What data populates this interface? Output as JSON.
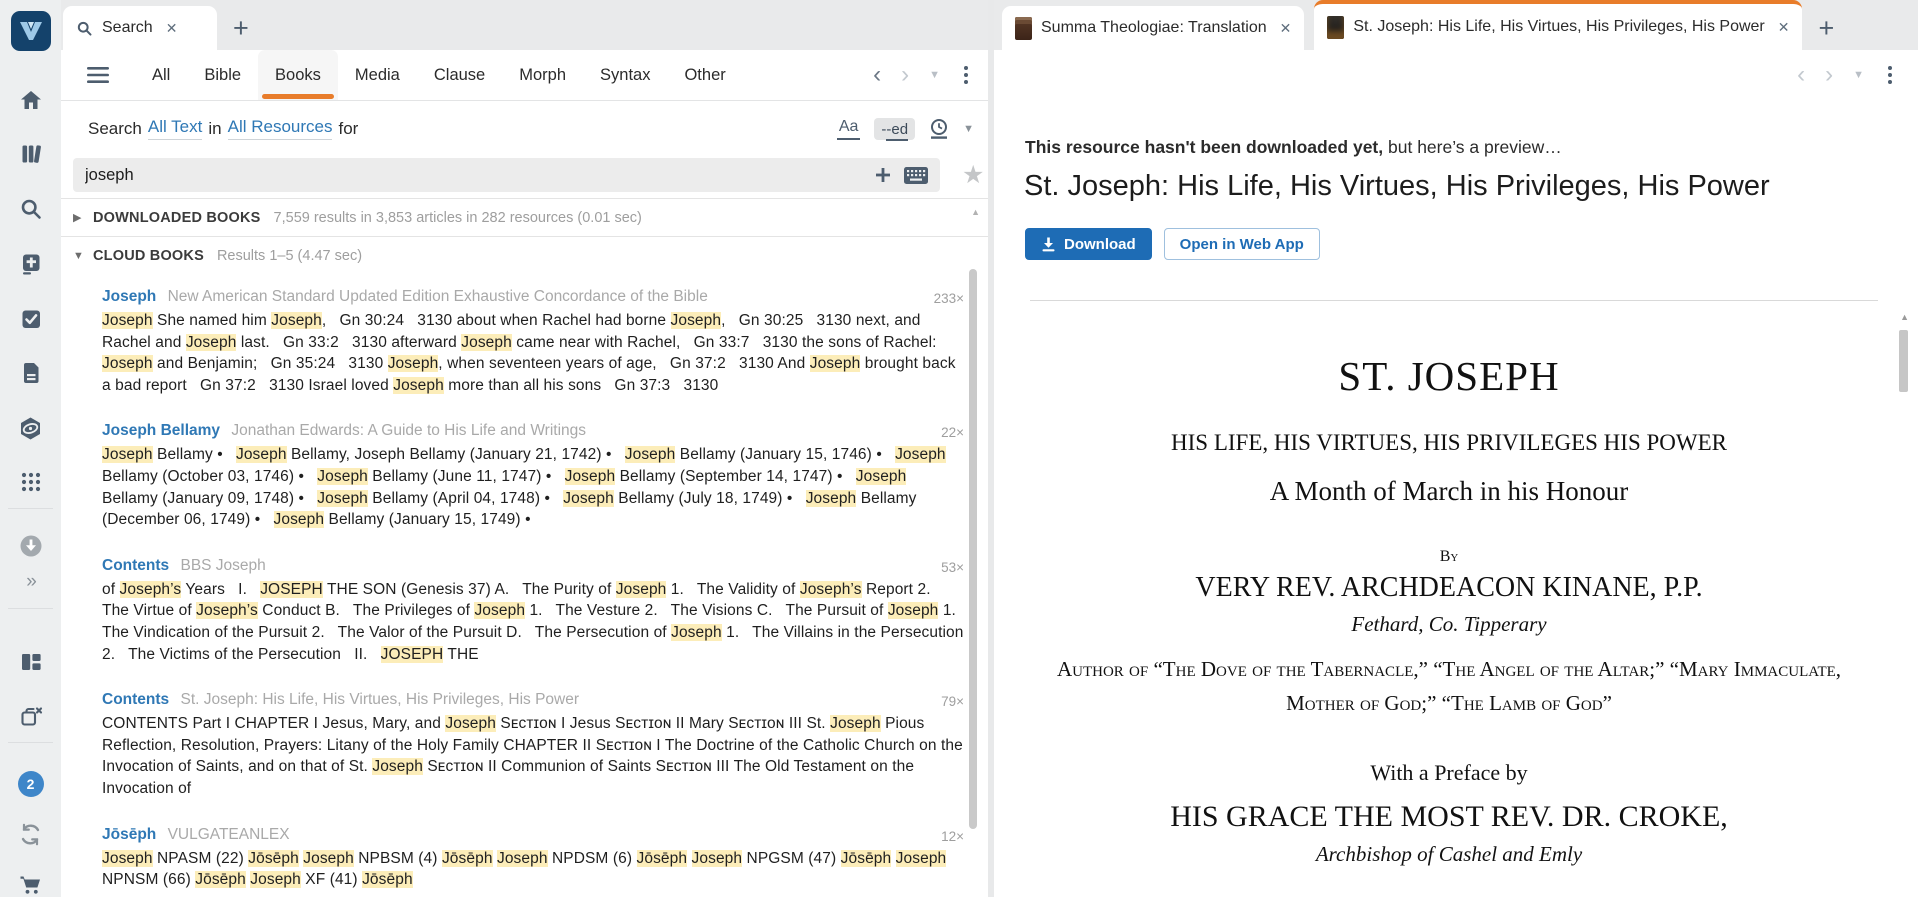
{
  "colors": {
    "accent_orange": "#e87c2a",
    "link_blue": "#2f78b5",
    "highlight_yellow": "#fcedb9",
    "button_blue": "#1e6cb5",
    "sidebar_bg": "#edeff0",
    "icon_slate": "#4d5d6e"
  },
  "sidebar": {
    "badge_count": "2",
    "icons": [
      "logos-logo-icon",
      "home-icon",
      "library-icon",
      "search-icon",
      "bible-cross-icon",
      "guides-check-icon",
      "documents-icon",
      "atlas-icon",
      "apps-grid-icon",
      "downloads-icon",
      "expand-chevrons-icon",
      "layouts-icon",
      "close-all-panels-icon",
      "notifications-badge",
      "sync-icon",
      "store-cart-icon"
    ]
  },
  "left_panel": {
    "tab_label": "Search",
    "new_tab_label": "+",
    "nav_tabs": [
      {
        "label": "All",
        "active": false
      },
      {
        "label": "Bible",
        "active": false
      },
      {
        "label": "Books",
        "active": true
      },
      {
        "label": "Media",
        "active": false
      },
      {
        "label": "Clause",
        "active": false
      },
      {
        "label": "Morph",
        "active": false
      },
      {
        "label": "Syntax",
        "active": false
      },
      {
        "label": "Other",
        "active": false
      }
    ],
    "criteria": {
      "prefix": "Search",
      "all_text": "All Text",
      "in_word": "in",
      "all_resources": "All Resources",
      "suffix": "for"
    },
    "match_case_label": "Aa",
    "match_forms_label": "-ed",
    "query": "joseph",
    "sections": {
      "downloaded": {
        "label": "DOWNLOADED BOOKS",
        "summary": "7,559 results in 3,853 articles in 282 resources (0.01 sec)"
      },
      "cloud": {
        "label": "CLOUD BOOKS",
        "summary": "Results 1–5 (4.47 sec)"
      }
    },
    "results": [
      {
        "title": "Joseph",
        "source": "New American Standard Updated Edition Exhaustive Concordance of the Bible",
        "count": "233×",
        "snippet": [
          [
            "Joseph",
            1
          ],
          [
            " She named him ",
            0
          ],
          [
            "Joseph",
            1
          ],
          [
            ",   Gn 30:24   3130 about when Rachel had borne ",
            0
          ],
          [
            "Joseph",
            1
          ],
          [
            ",   Gn 30:25   3130 next, and Rachel and ",
            0
          ],
          [
            "Joseph",
            1
          ],
          [
            " last.   Gn 33:2   3130 afterward ",
            0
          ],
          [
            "Joseph",
            1
          ],
          [
            " came near with Rachel,   Gn 33:7   3130 the sons of Rachel: ",
            0
          ],
          [
            "Joseph",
            1
          ],
          [
            " and Benjamin;   Gn 35:24   3130 ",
            0
          ],
          [
            "Joseph",
            1
          ],
          [
            ", when seventeen years of age,   Gn 37:2   3130 And ",
            0
          ],
          [
            "Joseph",
            1
          ],
          [
            " brought back a bad report   Gn 37:2   3130 Israel loved ",
            0
          ],
          [
            "Joseph",
            1
          ],
          [
            " more than all his sons   Gn 37:3   3130",
            0
          ]
        ]
      },
      {
        "title": "Joseph Bellamy",
        "source": "Jonathan Edwards: A Guide to His Life and Writings",
        "count": "22×",
        "snippet": [
          [
            "Joseph",
            1
          ],
          [
            " Bellamy •   ",
            0
          ],
          [
            "Joseph",
            1
          ],
          [
            " Bellamy, Joseph Bellamy (January 21, 1742) •   ",
            0
          ],
          [
            "Joseph",
            1
          ],
          [
            " Bellamy (January 15, 1746) •   ",
            0
          ],
          [
            "Joseph",
            1
          ],
          [
            " Bellamy (October 03, 1746) •   ",
            0
          ],
          [
            "Joseph",
            1
          ],
          [
            " Bellamy (June 11, 1747) •   ",
            0
          ],
          [
            "Joseph",
            1
          ],
          [
            " Bellamy (September 14, 1747) •   ",
            0
          ],
          [
            "Joseph",
            1
          ],
          [
            " Bellamy (January 09, 1748) •   ",
            0
          ],
          [
            "Joseph",
            1
          ],
          [
            " Bellamy (April 04, 1748) •   ",
            0
          ],
          [
            "Joseph",
            1
          ],
          [
            " Bellamy (July 18, 1749) •   ",
            0
          ],
          [
            "Joseph",
            1
          ],
          [
            " Bellamy (December 06, 1749) •   ",
            0
          ],
          [
            "Joseph",
            1
          ],
          [
            " Bellamy (January 15, 1749) •",
            0
          ]
        ]
      },
      {
        "title": "Contents",
        "source": "BBS Joseph",
        "count": "53×",
        "snippet": [
          [
            "of ",
            0
          ],
          [
            "Joseph’s",
            1
          ],
          [
            " Years   I.   ",
            0
          ],
          [
            "JOSEPH",
            1
          ],
          [
            " THE SON (Genesis 37) A.   The Purity of ",
            0
          ],
          [
            "Joseph",
            1
          ],
          [
            " 1.   The Validity of ",
            0
          ],
          [
            "Joseph’s",
            1
          ],
          [
            " Report 2.   The Virtue of ",
            0
          ],
          [
            "Joseph’s",
            1
          ],
          [
            " Conduct B.   The Privileges of ",
            0
          ],
          [
            "Joseph",
            1
          ],
          [
            " 1.   The Vesture 2.   The Visions C.   The Pursuit of ",
            0
          ],
          [
            "Joseph",
            1
          ],
          [
            " 1.   The Vindication of the Pursuit 2.   The Valor of the Pursuit D.   The Persecution of ",
            0
          ],
          [
            "Joseph",
            1
          ],
          [
            " 1.   The Villains in the Persecution 2.   The Victims of the Persecution   II.   ",
            0
          ],
          [
            "JOSEPH",
            1
          ],
          [
            " THE",
            0
          ]
        ]
      },
      {
        "title": "Contents",
        "source": "St. Joseph: His Life, His Virtues, His Privileges, His Power",
        "count": "79×",
        "snippet": [
          [
            "CONTENTS Part I CHAPTER I Jesus, Mary, and ",
            0
          ],
          [
            "Joseph",
            1
          ],
          [
            " Sᴇᴄᴛɪᴏɴ I Jesus Sᴇᴄᴛɪᴏɴ II Mary Sᴇᴄᴛɪᴏɴ III St. ",
            0
          ],
          [
            "Joseph",
            1
          ],
          [
            " Pious Reflection, Resolution, Prayers: Litany of the Holy Family CHAPTER II Sᴇᴄᴛɪᴏɴ I The Doctrine of the Catholic Church on the Invocation of Saints, and on that of St. ",
            0
          ],
          [
            "Joseph",
            1
          ],
          [
            " Sᴇᴄᴛɪᴏɴ II Communion of Saints Sᴇᴄᴛɪᴏɴ III The Old Testament on the Invocation of",
            0
          ]
        ]
      },
      {
        "title": "Jōsēph",
        "source": "VULGATEANLEX",
        "count": "12×",
        "snippet": [
          [
            "Joseph",
            1
          ],
          [
            " NPASM (22) ",
            0
          ],
          [
            "Jōsēph",
            1
          ],
          [
            " ",
            0
          ],
          [
            "Joseph",
            1
          ],
          [
            " NPBSM (4) ",
            0
          ],
          [
            "Jōsēph",
            1
          ],
          [
            " ",
            0
          ],
          [
            "Joseph",
            1
          ],
          [
            " NPDSM (6) ",
            0
          ],
          [
            "Jōsēph",
            1
          ],
          [
            " ",
            0
          ],
          [
            "Joseph",
            1
          ],
          [
            " NPGSM (47) ",
            0
          ],
          [
            "Jōsēph",
            1
          ],
          [
            " ",
            0
          ],
          [
            "Joseph",
            1
          ],
          [
            " NPNSM (66) ",
            0
          ],
          [
            "Jōsēph",
            1
          ],
          [
            " ",
            0
          ],
          [
            "Joseph",
            1
          ],
          [
            " XF (41) ",
            0
          ],
          [
            "Jōsēph",
            1
          ]
        ]
      }
    ]
  },
  "right_panel": {
    "tabs": [
      {
        "label": "Summa Theologiae: Translation",
        "active": false
      },
      {
        "label": "St. Joseph: His Life, His Virtues, His Privileges, His Power",
        "active": true
      }
    ],
    "new_tab_label": "+",
    "notice_bold": "This resource hasn't been downloaded yet,",
    "notice_rest": " but here’s a preview…",
    "resource_title": "St. Joseph: His Life, His Virtues, His Privileges, His Power",
    "download_button": "Download",
    "open_web_button": "Open in Web App",
    "doc": {
      "title": "ST. JOSEPH",
      "subtitle": "HIS LIFE, HIS VIRTUES, HIS PRIVILEGES HIS POWER",
      "month_line": "A Month of March in his Honour",
      "by": "By",
      "author": "VERY REV. ARCHDEACON KINANE, P.P.",
      "author_place": "Fethard, Co. Tipperary",
      "author_of_line1": "Author of “The Dove of the Tabernacle,” “The Angel of the Altar;” “Mary Immaculate,",
      "author_of_line2": "Mother of God;” “The Lamb of God”",
      "preface_line": "With a Preface by",
      "preface_author": "HIS GRACE THE MOST REV. DR. CROKE,",
      "preface_author_title": "Archbishop of Cashel and Emly"
    }
  }
}
